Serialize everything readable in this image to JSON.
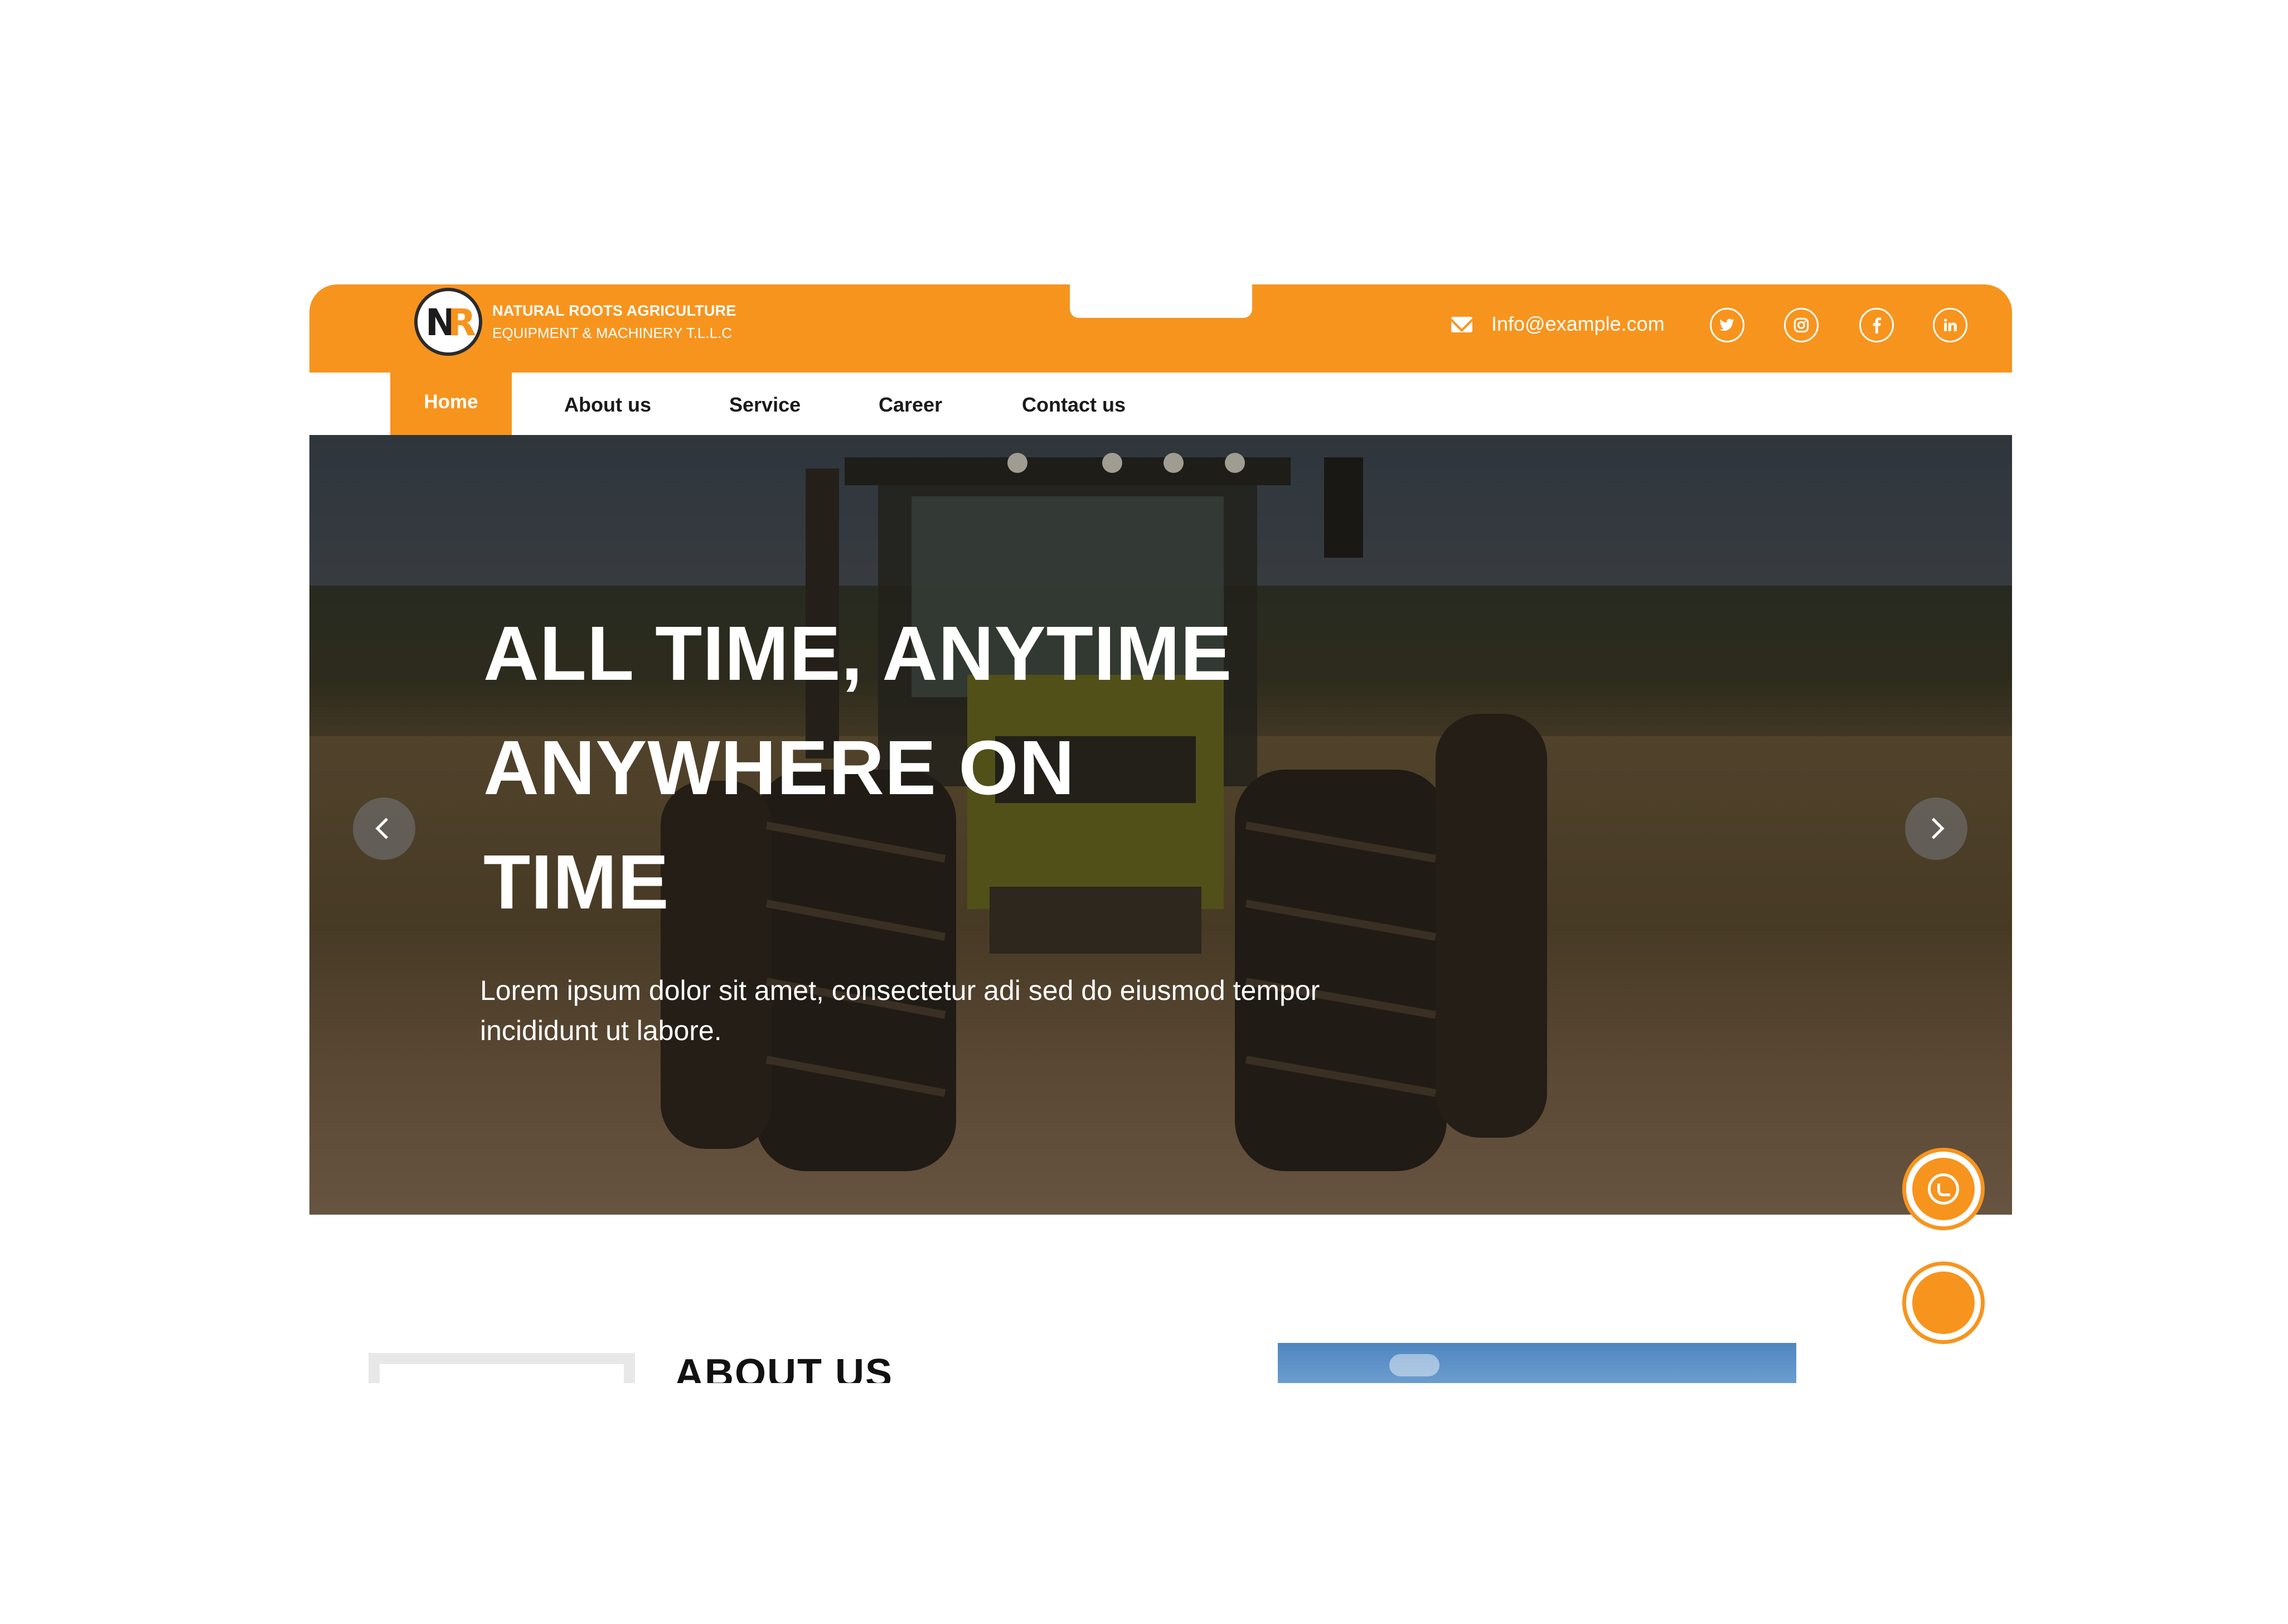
{
  "header": {
    "brand_line1": "NATURAL ROOTS AGRICULTURE",
    "brand_line2": "EQUIPMENT & MACHINERY T.L.L.C",
    "logo_letters": {
      "n": "N",
      "r": "R"
    },
    "email": "Info@example.com",
    "social": {
      "twitter": "twitter-icon",
      "instagram": "instagram-icon",
      "facebook": "facebook-icon",
      "linkedin": "linkedin-icon"
    }
  },
  "nav": {
    "items": [
      {
        "label": "Home",
        "active": true
      },
      {
        "label": "About us",
        "active": false
      },
      {
        "label": "Service",
        "active": false
      },
      {
        "label": "Career",
        "active": false
      },
      {
        "label": "Contact us",
        "active": false
      }
    ]
  },
  "hero": {
    "title_lines": [
      "ALL TIME, ANYTIME",
      "ANYWHERE ON",
      "TIME"
    ],
    "text": "Lorem ipsum dolor sit amet, consectetur adi sed do eiusmod tempor incididunt ut labore.",
    "prev_icon": "chevron-left-icon",
    "next_icon": "chevron-right-icon"
  },
  "floating": {
    "whatsapp_icon": "whatsapp-icon",
    "scroll_icon": "circle-button-icon"
  },
  "about": {
    "title": "ABOUT US"
  },
  "colors": {
    "accent": "#f7941e",
    "text_dark": "#1a1a1a",
    "white": "#ffffff"
  }
}
